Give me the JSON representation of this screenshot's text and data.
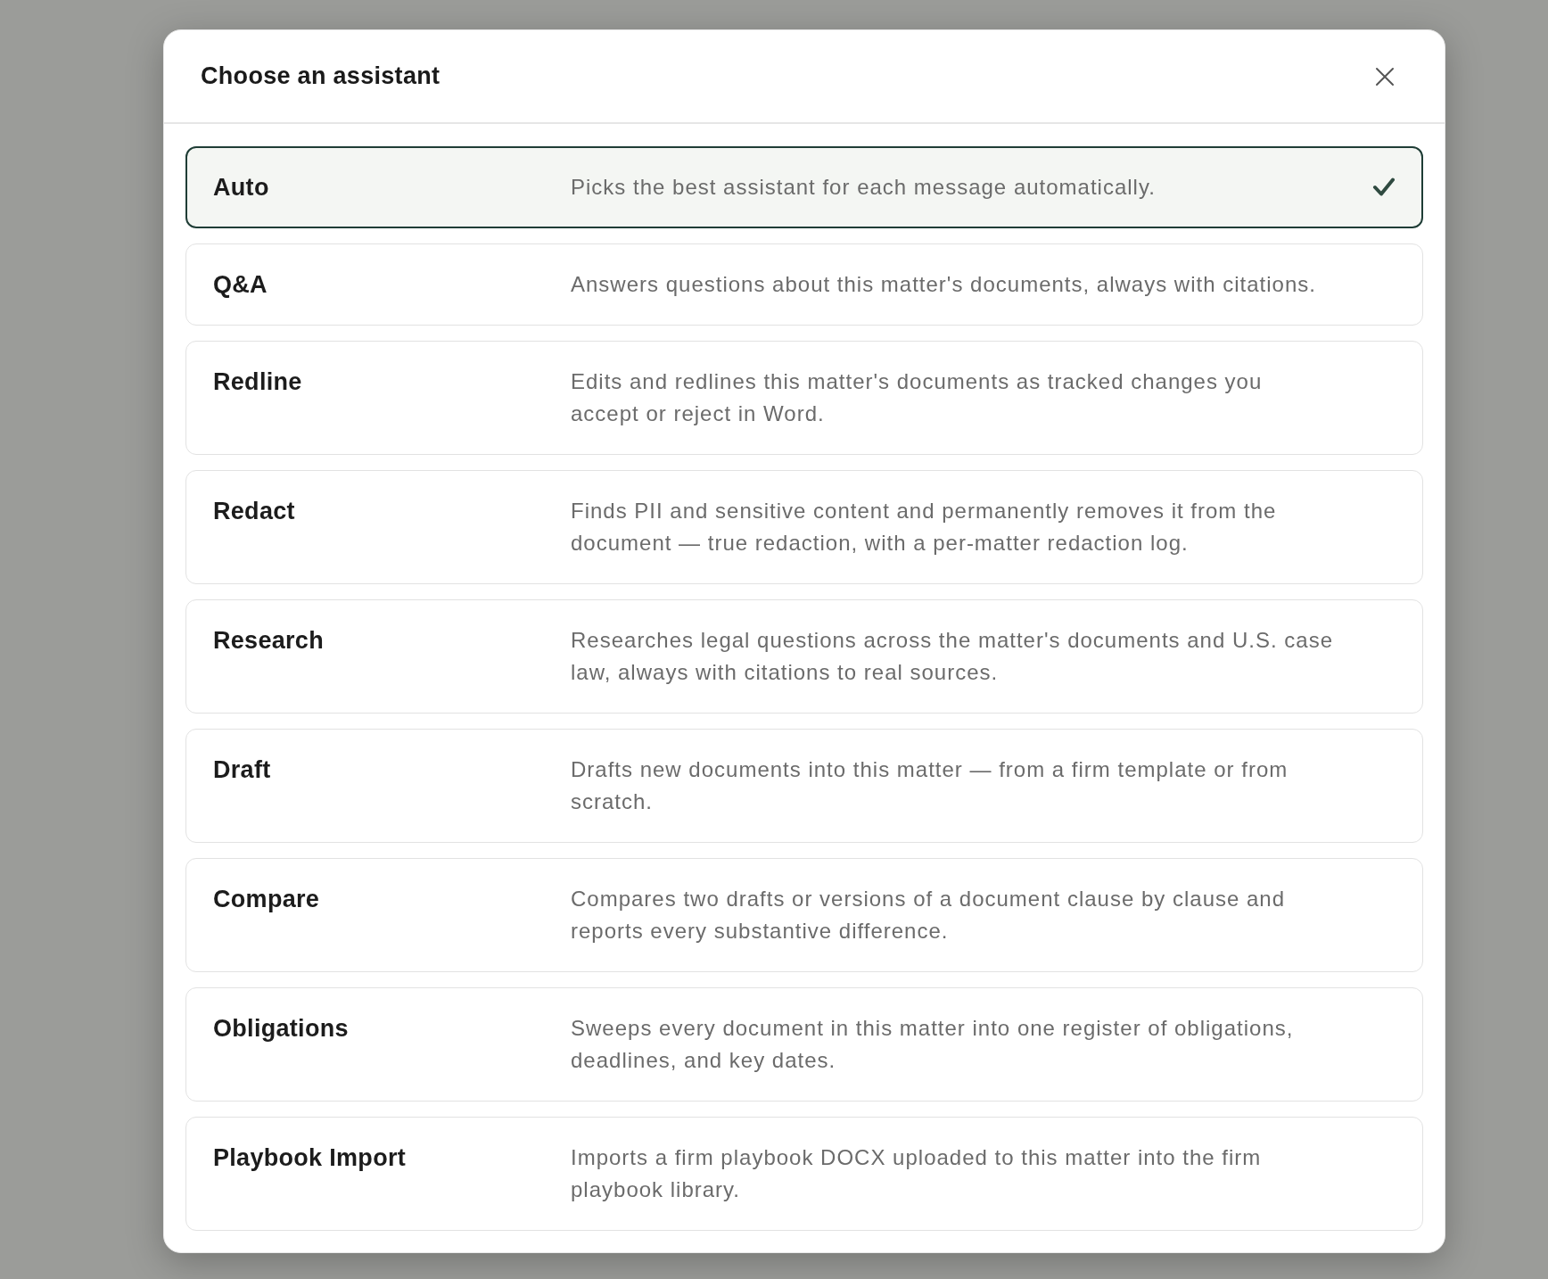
{
  "dialog": {
    "title": "Choose an assistant",
    "assistants": [
      {
        "name": "Auto",
        "description": "Picks the best assistant for each message automatically.",
        "selected": true
      },
      {
        "name": "Q&A",
        "description": "Answers questions about this matter's documents, always with citations.",
        "selected": false
      },
      {
        "name": "Redline",
        "description": "Edits and redlines this matter's documents as tracked changes you accept or reject in Word.",
        "selected": false
      },
      {
        "name": "Redact",
        "description": "Finds PII and sensitive content and permanently removes it from the document — true redaction, with a per-matter redaction log.",
        "selected": false
      },
      {
        "name": "Research",
        "description": "Researches legal questions across the matter's documents and U.S. case law, always with citations to real sources.",
        "selected": false
      },
      {
        "name": "Draft",
        "description": "Drafts new documents into this matter — from a firm template or from scratch.",
        "selected": false
      },
      {
        "name": "Compare",
        "description": "Compares two drafts or versions of a document clause by clause and reports every substantive difference.",
        "selected": false
      },
      {
        "name": "Obligations",
        "description": "Sweeps every document in this matter into one register of obligations, deadlines, and key dates.",
        "selected": false
      },
      {
        "name": "Playbook Import",
        "description": "Imports a firm playbook DOCX uploaded to this matter into the firm playbook library.",
        "selected": false
      }
    ]
  }
}
